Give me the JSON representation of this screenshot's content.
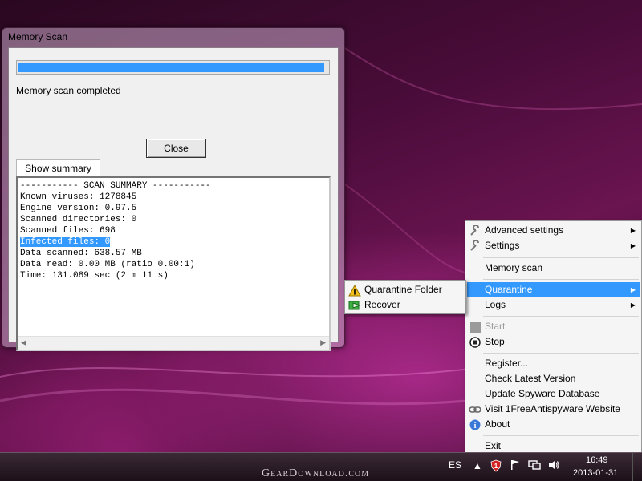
{
  "memory_scan_window": {
    "title": "Memory Scan",
    "progress_fraction": 0.985,
    "status_text": "Memory scan completed",
    "close_button_label": "Close",
    "summary_tab_label": "Show summary",
    "log_lines": [
      "----------- SCAN SUMMARY -----------",
      "Known viruses: 1278845",
      "Engine version: 0.97.5",
      "Scanned directories: 0",
      "Scanned files: 698",
      "Infected files: 0",
      "Data scanned: 638.57 MB",
      "Data read: 0.00 MB (ratio 0.00:1)",
      "Time: 131.089 sec (2 m 11 s)"
    ],
    "highlighted_line_index": 5
  },
  "context_menu": {
    "items": [
      {
        "label": "Advanced settings",
        "icon": "wrench-icon",
        "submenu": true
      },
      {
        "label": "Settings",
        "icon": "wrench-icon",
        "submenu": true
      },
      {
        "label": "Memory scan"
      },
      {
        "label": "Quarantine",
        "submenu": true,
        "active": true
      },
      {
        "label": "Logs",
        "submenu": true
      },
      {
        "label": "Start",
        "icon": "start-icon",
        "disabled": true
      },
      {
        "label": "Stop",
        "icon": "stop-icon"
      },
      {
        "label": "Register..."
      },
      {
        "label": "Check Latest Version"
      },
      {
        "label": "Update Spyware Database"
      },
      {
        "label": "Visit 1FreeAntispyware Website",
        "icon": "link-icon"
      },
      {
        "label": "About",
        "icon": "info-icon"
      },
      {
        "label": "Exit"
      }
    ]
  },
  "quarantine_submenu": {
    "items": [
      {
        "label": "Quarantine Folder",
        "icon": "warning-icon"
      },
      {
        "label": "Recover",
        "icon": "recover-icon"
      }
    ]
  },
  "taskbar": {
    "watermark": "GearDownload.com",
    "language": "ES",
    "notification_badge": "1",
    "clock_time": "16:49",
    "clock_date": "2013-01-31"
  },
  "colors": {
    "selection": "#3399ff",
    "menu_background": "#f5f5f5"
  }
}
